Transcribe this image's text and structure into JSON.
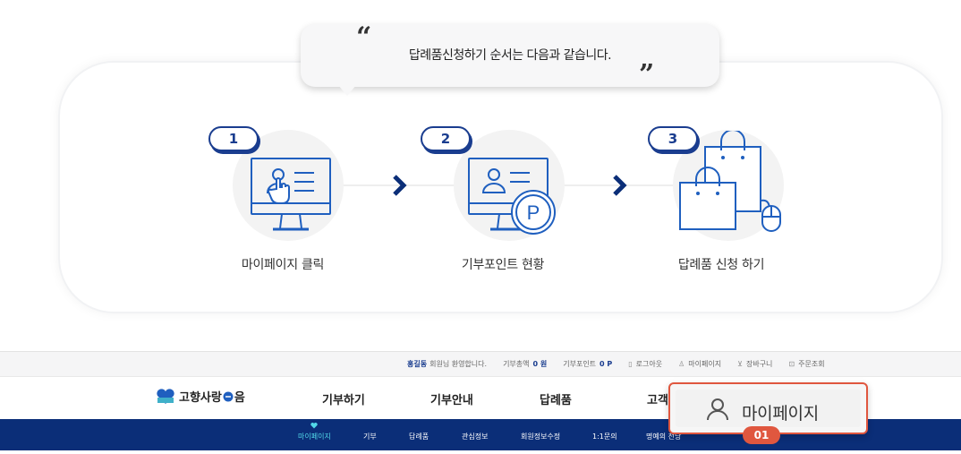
{
  "guide": {
    "intro_text": "답례품신청하기 순서는 다음과 같습니다.",
    "open_quote": "“",
    "close_quote": "”",
    "steps": [
      {
        "number": "1",
        "label": "마이페이지 클릭",
        "icon": "monitor-click-icon"
      },
      {
        "number": "2",
        "label": "기부포인트 현황",
        "icon": "monitor-point-icon"
      },
      {
        "number": "3",
        "label": "답례품 신청 하기",
        "icon": "shopping-bags-icon"
      }
    ],
    "point_symbol": "P"
  },
  "site": {
    "topbar": {
      "user_name": "홍길동",
      "welcome": "회원님 환영합니다.",
      "donation_total_label": "기부총액",
      "donation_total_value": "0 원",
      "donation_point_label": "기부포인트",
      "donation_point_value": "0 P",
      "logout": "로그아웃",
      "mypage": "마이페이지",
      "cart": "장바구니",
      "order_lookup": "주문조회"
    },
    "logo_text": "고향사랑",
    "logo_suffix": "음",
    "nav": [
      "기부하기",
      "기부안내",
      "답례품",
      "고객"
    ],
    "subnav": [
      "마이페이지",
      "기부",
      "답례품",
      "관심정보",
      "회원정보수정",
      "1:1문의",
      "명예의 전당"
    ]
  },
  "callout": {
    "label": "마이페이지",
    "badge": "01"
  },
  "colors": {
    "navy": "#0b2e78",
    "accent": "#1a3d8f",
    "highlight": "#e0573f",
    "icon_blue": "#1f5fbf",
    "active_sub": "#52d8e8"
  }
}
